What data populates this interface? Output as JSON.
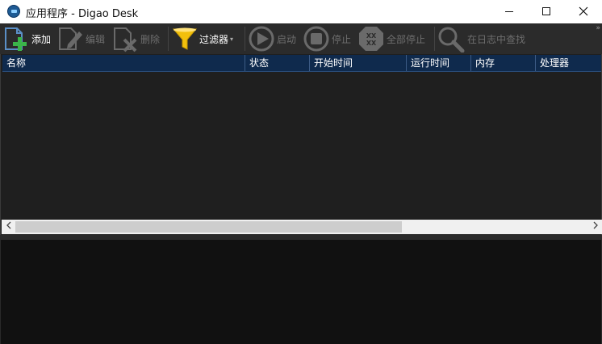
{
  "window": {
    "title": "应用程序 - Digao Desk"
  },
  "toolbar": {
    "add_label": "添加",
    "edit_label": "编辑",
    "delete_label": "删除",
    "filter_label": "过滤器",
    "start_label": "启动",
    "stop_label": "停止",
    "stop_all_label": "全部停止",
    "search_log_label": "在日志中查找",
    "overflow": "»"
  },
  "grid": {
    "columns": [
      "名称",
      "状态",
      "开始时间",
      "运行时间",
      "内存",
      "处理器"
    ],
    "rows": []
  },
  "colors": {
    "toolbar_bg": "#2b2b2b",
    "header_bg": "#0f2a4d",
    "grid_bg": "#1f1f1f",
    "log_bg": "#111111",
    "add_green": "#3bb54a",
    "filter_yellow": "#f2c00c"
  }
}
